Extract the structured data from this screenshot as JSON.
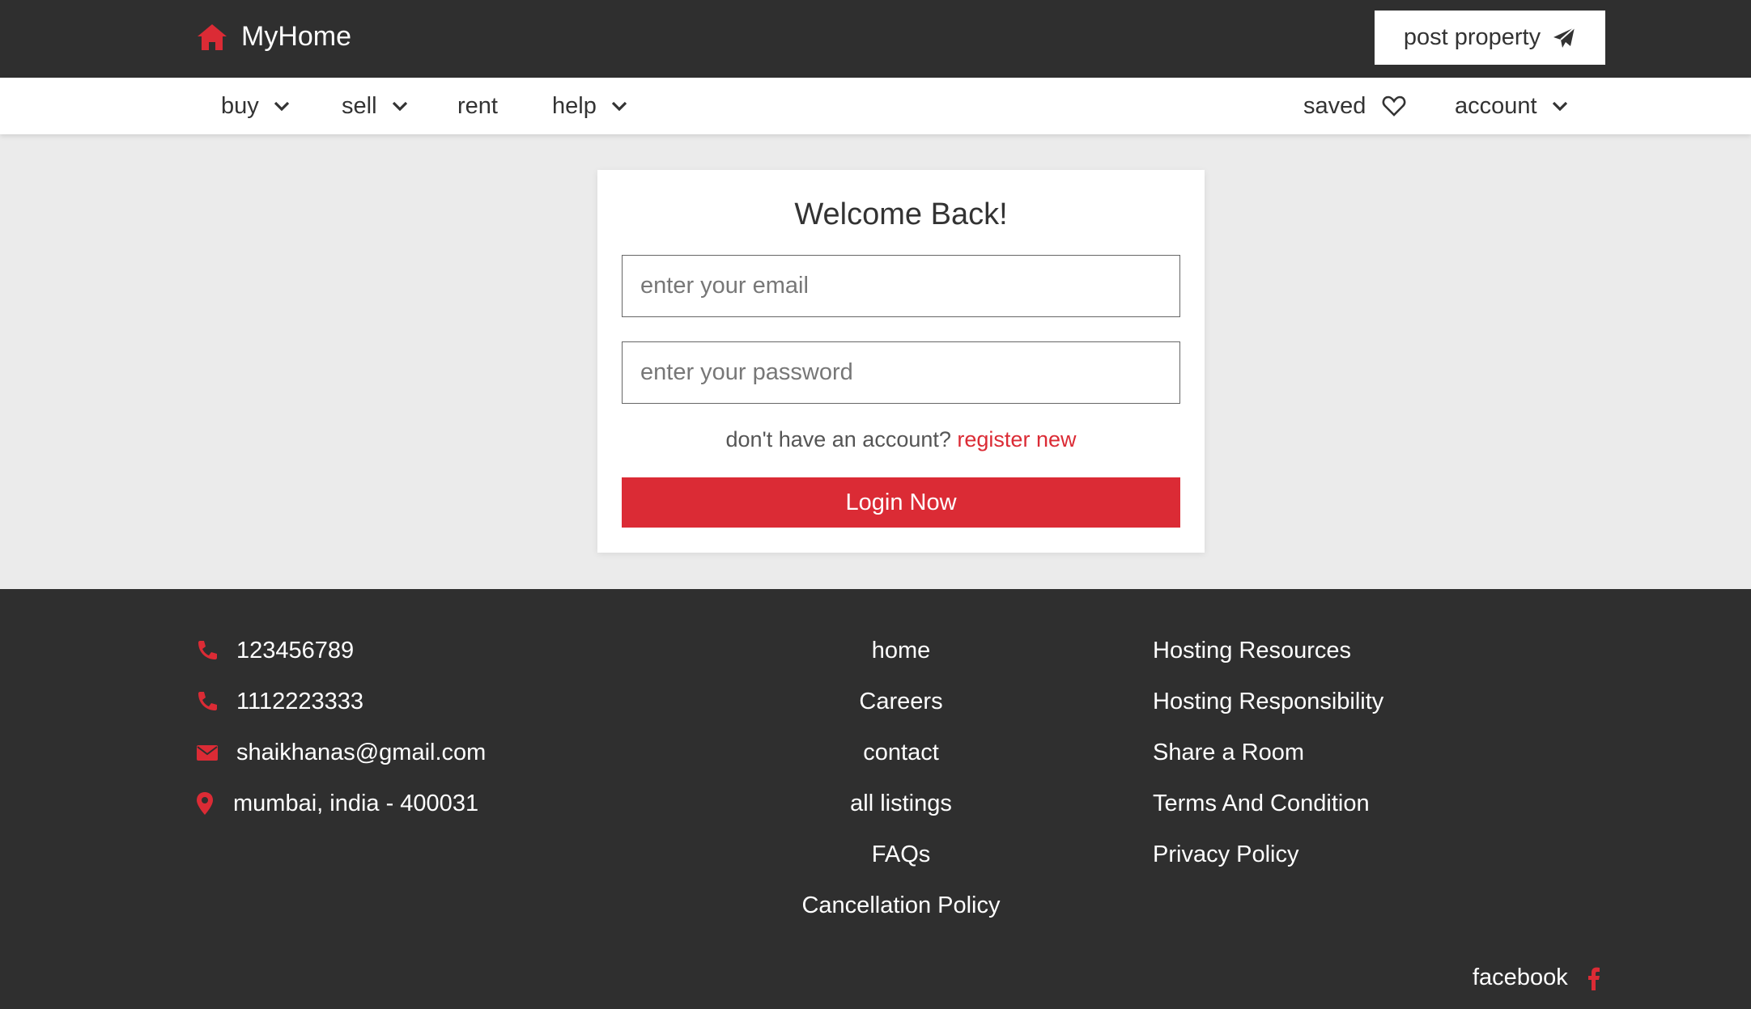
{
  "header": {
    "brand": "MyHome",
    "post_property_label": "post property"
  },
  "nav": {
    "buy": "buy",
    "sell": "sell",
    "rent": "rent",
    "help": "help",
    "saved": "saved",
    "account": "account"
  },
  "login": {
    "title": "Welcome Back!",
    "email_placeholder": "enter your email",
    "email_value": "",
    "password_placeholder": "enter your password",
    "password_value": "",
    "no_account_text": "don't have an account?",
    "register_link": "register new",
    "submit_label": "Login Now"
  },
  "footer": {
    "contacts": {
      "phone1": "123456789",
      "phone2": "1112223333",
      "email": "shaikhanas@gmail.com",
      "address": "mumbai, india - 400031"
    },
    "links_center": [
      "home",
      "Careers",
      "contact",
      "all listings",
      "FAQs",
      "Cancellation Policy"
    ],
    "links_right": [
      "Hosting Resources",
      "Hosting Responsibility",
      "Share a Room",
      "Terms And Condition",
      "Privacy Policy"
    ],
    "social": "facebook"
  },
  "colors": {
    "accent": "#db2b35",
    "dark": "#2f2f2f",
    "background": "#ebebeb"
  },
  "icons": {
    "logo": "home-icon",
    "post": "paper-plane-icon",
    "dropdown": "chevron-down-icon",
    "saved": "heart-icon",
    "phone": "phone-icon",
    "email": "envelope-icon",
    "address": "map-pin-icon",
    "social": "facebook-icon"
  }
}
